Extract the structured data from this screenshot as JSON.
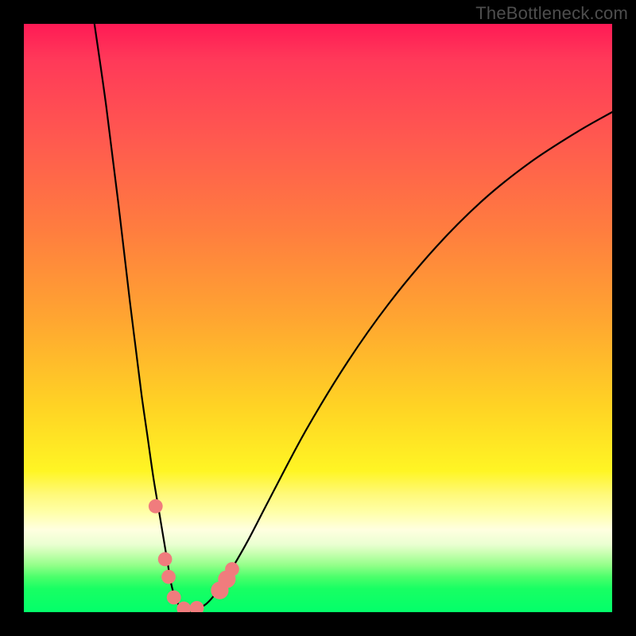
{
  "watermark": "TheBottleneck.com",
  "chart_data": {
    "type": "line",
    "title": "",
    "xlabel": "",
    "ylabel": "",
    "xlim": [
      0,
      100
    ],
    "ylim": [
      0,
      100
    ],
    "grid": false,
    "series": [
      {
        "name": "curve",
        "color": "#000000",
        "x": [
          12,
          14,
          16,
          18,
          19,
          20,
          21,
          22,
          23,
          24,
          24.5,
          25,
          25.7,
          26.5,
          27.5,
          29,
          31,
          33,
          35,
          38,
          42,
          48,
          55,
          62,
          70,
          78,
          86,
          94,
          100
        ],
        "y": [
          100,
          86,
          70,
          53,
          45,
          37,
          30,
          23,
          17,
          11,
          8,
          5,
          2.5,
          1,
          0.2,
          0.4,
          1.4,
          3.7,
          6.8,
          12.0,
          19.7,
          31.0,
          42.5,
          52.4,
          62.0,
          70.0,
          76.4,
          81.6,
          85.0
        ]
      }
    ],
    "points": [
      {
        "name": "p1",
        "color": "#f07c7d",
        "x": 22.4,
        "y": 18.0,
        "r": 1.2
      },
      {
        "name": "p2",
        "color": "#f07c7d",
        "x": 24.0,
        "y": 9.0,
        "r": 1.2
      },
      {
        "name": "p3",
        "color": "#f07c7d",
        "x": 24.6,
        "y": 6.0,
        "r": 1.2
      },
      {
        "name": "p4",
        "color": "#f07c7d",
        "x": 25.5,
        "y": 2.5,
        "r": 1.2
      },
      {
        "name": "p5",
        "color": "#f07c7d",
        "x": 27.2,
        "y": 0.6,
        "r": 1.2
      },
      {
        "name": "p6",
        "color": "#f07c7d",
        "x": 29.4,
        "y": 0.7,
        "r": 1.2
      },
      {
        "name": "p7",
        "color": "#f07c7d",
        "x": 33.3,
        "y": 3.7,
        "r": 1.5
      },
      {
        "name": "p8",
        "color": "#f07c7d",
        "x": 34.5,
        "y": 5.6,
        "r": 1.5
      },
      {
        "name": "p9",
        "color": "#f07c7d",
        "x": 35.4,
        "y": 7.3,
        "r": 1.2
      }
    ]
  }
}
